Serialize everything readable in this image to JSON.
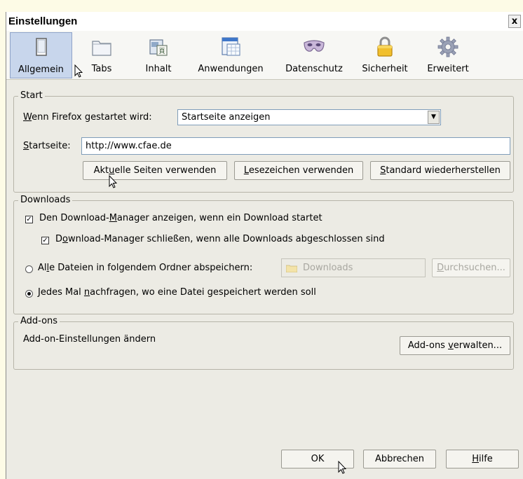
{
  "window": {
    "title": "Einstellungen",
    "close_glyph": "x"
  },
  "toolbar": {
    "items": [
      {
        "label": "Allgemein",
        "icon": "general-icon"
      },
      {
        "label": "Tabs",
        "icon": "tabs-icon"
      },
      {
        "label": "Inhalt",
        "icon": "content-icon"
      },
      {
        "label": "Anwendungen",
        "icon": "applications-icon"
      },
      {
        "label": "Datenschutz",
        "icon": "privacy-mask-icon"
      },
      {
        "label": "Sicherheit",
        "icon": "lock-icon"
      },
      {
        "label": "Erweitert",
        "icon": "gear-icon"
      }
    ],
    "selected": "Allgemein"
  },
  "start": {
    "legend": "Start",
    "startup_label_first": "W",
    "startup_label_rest": "enn Firefox gestartet wird:",
    "startup_select_value": "Startseite anzeigen",
    "homepage_label_first": "S",
    "homepage_label_rest": "tartseite:",
    "homepage_value": "http://www.cfae.de",
    "btn_current_a": "Akt",
    "btn_current_u": "u",
    "btn_current_b": "elle Seiten verwenden",
    "btn_bookmark_u": "L",
    "btn_bookmark_rest": "esezeichen verwenden",
    "btn_default_u": "S",
    "btn_default_rest": "tandard wiederherstellen"
  },
  "downloads": {
    "legend": "Downloads",
    "show_manager_a": "Den Download-",
    "show_manager_u": "M",
    "show_manager_b": "anager anzeigen, wenn ein Download startet",
    "show_manager_checked": true,
    "close_manager_a": "D",
    "close_manager_u": "o",
    "close_manager_b": "wnload-Manager schließen, wenn alle Downloads abgeschlossen sind",
    "close_manager_checked": true,
    "save_to_a": "Al",
    "save_to_u": "l",
    "save_to_b": "e Dateien in folgendem Ordner abspeichern:",
    "folder_value": "Downloads",
    "browse_u": "D",
    "browse_rest": "urchsuchen...",
    "ask_a": "Jedes Mal ",
    "ask_u": "n",
    "ask_b": "achfragen, wo eine Datei gespeichert werden soll",
    "ask_selected": true
  },
  "addons": {
    "legend": "Add-ons",
    "description": "Add-on-Einstellungen ändern",
    "manage_a": "Add-ons ",
    "manage_u": "v",
    "manage_b": "erwalten..."
  },
  "footer": {
    "ok": "OK",
    "cancel": "Abbrechen",
    "help_u": "H",
    "help_rest": "ilfe"
  },
  "colors": {
    "dialog_bg": "#ecebe4",
    "selected_tab_bg": "#c8d6ec",
    "page_bg": "#fdfbe6"
  }
}
